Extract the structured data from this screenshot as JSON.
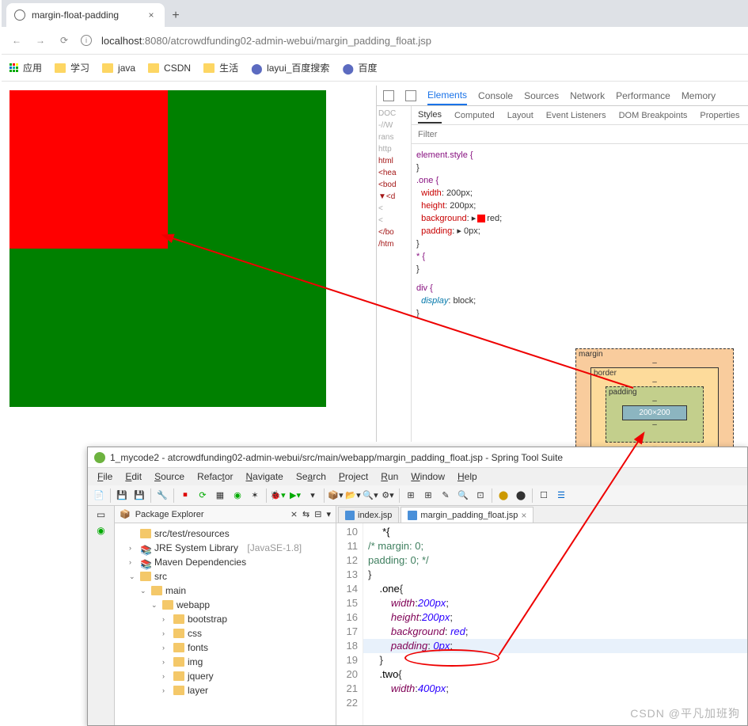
{
  "browser": {
    "tabTitle": "margin-float-padding",
    "url_host": "localhost",
    "url_port": ":8080",
    "url_path": "/atcrowdfunding02-admin-webui/margin_padding_float.jsp",
    "newtab": "+"
  },
  "bookmarks": {
    "apps": "应用",
    "items": [
      "学习",
      "java",
      "CSDN",
      "生活",
      "layui_百度搜索",
      "百度"
    ]
  },
  "devtools": {
    "topTabs": [
      "Elements",
      "Console",
      "Sources",
      "Network",
      "Performance",
      "Memory"
    ],
    "subTabs": [
      "Styles",
      "Computed",
      "Layout",
      "Event Listeners",
      "DOM Breakpoints",
      "Properties"
    ],
    "filter": "Filter",
    "dom": [
      "DOC",
      "-//W",
      "rans",
      "http",
      "html",
      "<hea",
      "<bod",
      "▼<d",
      "<",
      "<",
      "</bo",
      "/htm"
    ],
    "rules": {
      "r0": "element.style {",
      "r0c": "}",
      "r1": ".one {",
      "p1": "width",
      "v1": "200px;",
      "p2": "height",
      "v2": "200px;",
      "p3": "background",
      "v3": "red;",
      "p4": "padding",
      "v4": "0px;",
      "r1c": "}",
      "r2": "* {",
      "r2c": "}",
      "r3": "div {",
      "p5": "display",
      "v5": "block;",
      "r3c": "}"
    },
    "box": {
      "margin": "margin",
      "border": "border",
      "padding": "padding",
      "content": "200×200",
      "dash": "–"
    }
  },
  "sts": {
    "title": "1_mycode2 - atcrowdfunding02-admin-webui/src/main/webapp/margin_padding_float.jsp - Spring Tool Suite",
    "menu": [
      "File",
      "Edit",
      "Source",
      "Refactor",
      "Navigate",
      "Search",
      "Project",
      "Run",
      "Window",
      "Help"
    ],
    "view": "Package Explorer",
    "tree": {
      "n0": "src/test/resources",
      "n1": "JRE System Library",
      "n1s": "[JavaSE-1.8]",
      "n2": "Maven Dependencies",
      "n3": "src",
      "n4": "main",
      "n5": "webapp",
      "c": [
        "bootstrap",
        "css",
        "fonts",
        "img",
        "jquery",
        "layer"
      ]
    },
    "tabs": {
      "t0": "index.jsp",
      "t1": "margin_padding_float.jsp"
    },
    "lines": [
      "10",
      "11",
      "12",
      "13",
      "14",
      "15",
      "16",
      "17",
      "18",
      "19",
      "20",
      "21",
      "22"
    ],
    "code": {
      "l10": "*{",
      "l11": "/*      margin: 0;",
      "l12": "       padding: 0; */",
      "l13": "    }",
      "l14": "",
      "l15": "    .one{",
      "l16": "        width:200px;",
      "l17": "        height:200px;",
      "l18": "        background: red;",
      "l19": "        padding: 0px;",
      "l20": "    }",
      "l21": "    .two{",
      "l22": "        width:400px;"
    }
  },
  "watermark": "CSDN @平凡加班狗"
}
